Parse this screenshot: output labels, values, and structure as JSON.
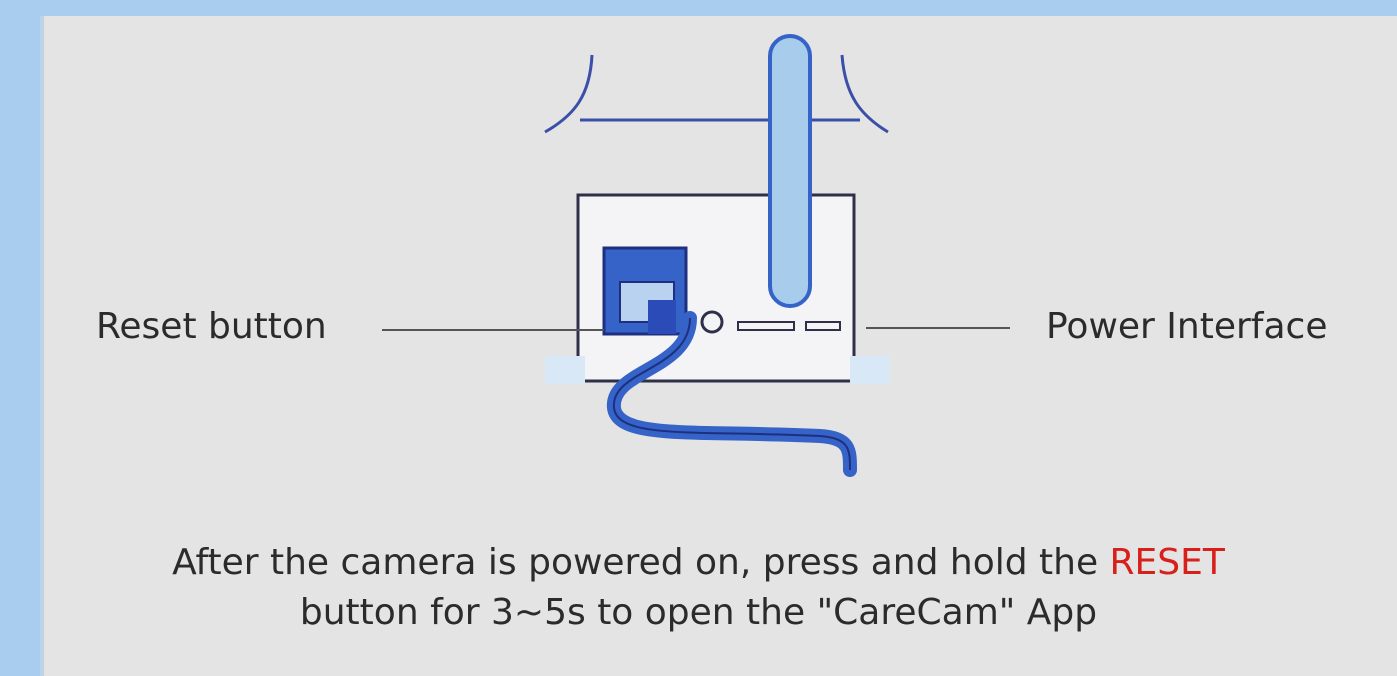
{
  "labels": {
    "reset_button": "Reset button",
    "power_interface": "Power Interface"
  },
  "caption": {
    "line1_prefix": "After the camera is powered on, press and hold the ",
    "line1_highlight": "RESET",
    "line2": "button for 3~5s to open the \"CareCam\" App"
  },
  "colors": {
    "page_background": "#a9cdee",
    "panel_background": "#e4e4e4",
    "accent_blue": "#3563c8",
    "highlight_red": "#d8201a"
  }
}
